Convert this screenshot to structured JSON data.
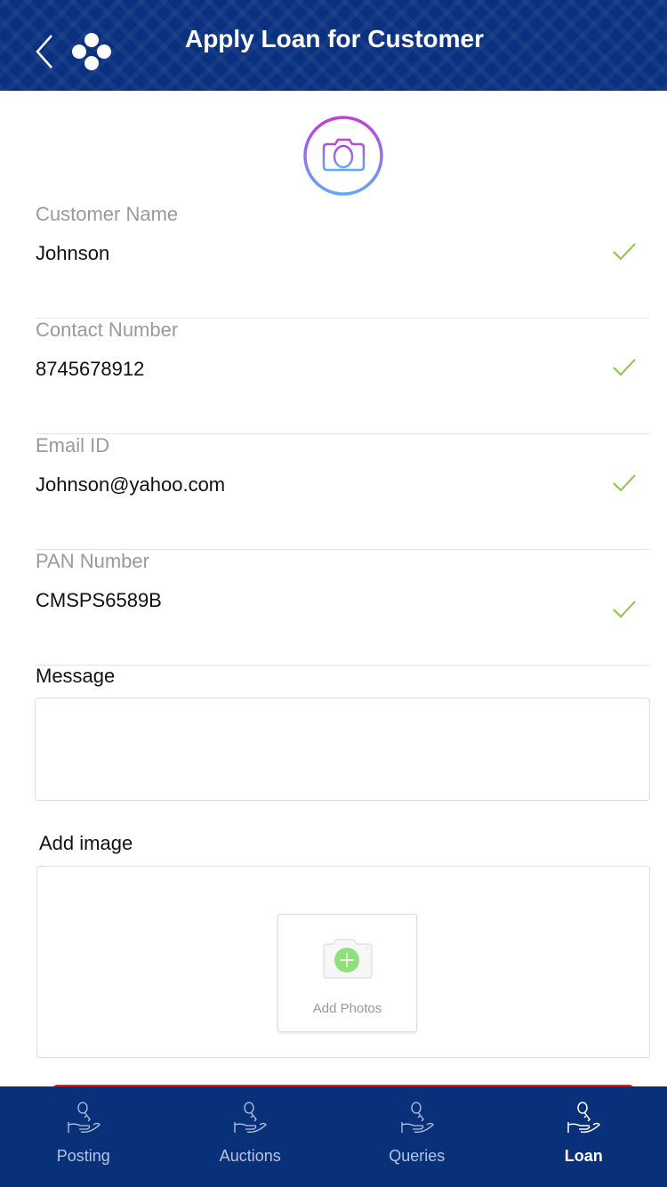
{
  "header": {
    "title": "Apply Loan for Customer",
    "back_icon": "chevron-left-icon",
    "logo_icon": "brand-logo-icon"
  },
  "avatar": {
    "icon": "camera-icon"
  },
  "fields": [
    {
      "label": "Customer Name",
      "value": "Johnson",
      "valid": true
    },
    {
      "label": "Contact Number",
      "value": "8745678912",
      "valid": true
    },
    {
      "label": "Email ID",
      "value": "Johnson@yahoo.com",
      "valid": true
    },
    {
      "label": "PAN Number",
      "value": "CMSPS6589B",
      "valid": true
    }
  ],
  "message": {
    "label": "Message",
    "value": ""
  },
  "add_image": {
    "label": "Add image",
    "button_label": "Add Photos"
  },
  "colors": {
    "primary": "#0a3180",
    "check": "#8bc34a",
    "accent_red": "#e51c23",
    "add_green": "#8ee07a"
  },
  "nav": {
    "items": [
      {
        "label": "Posting",
        "active": false
      },
      {
        "label": "Auctions",
        "active": false
      },
      {
        "label": "Queries",
        "active": false
      },
      {
        "label": "Loan",
        "active": true
      }
    ]
  }
}
